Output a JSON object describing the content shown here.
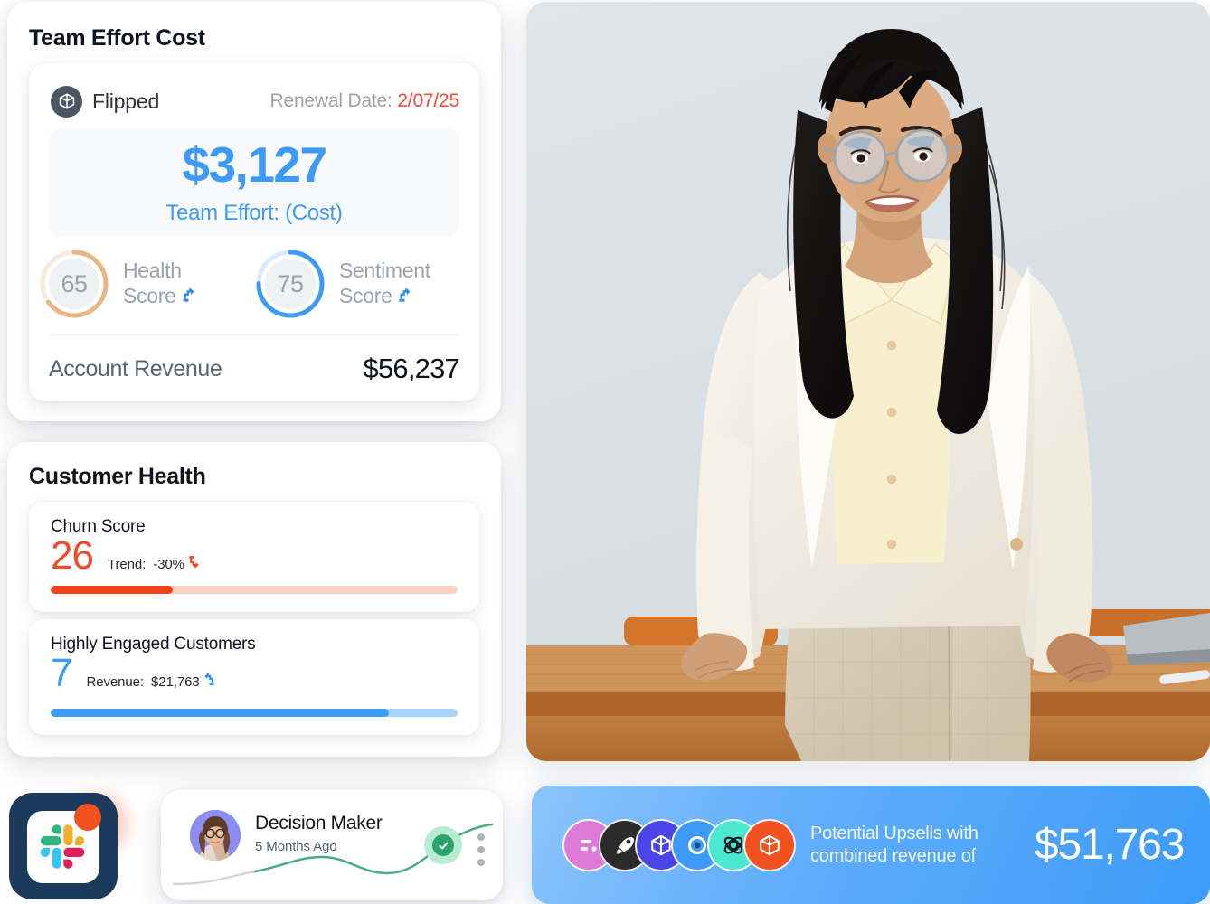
{
  "team_effort_card": {
    "title": "Team Effort Cost",
    "brand_name": "Flipped",
    "brand_icon": "cube-logo-icon",
    "renewal_label": "Renewal Date:",
    "renewal_date": "2/07/25",
    "value_amount": "$3,127",
    "value_caption": "Team Effort: (Cost)",
    "gauges": [
      {
        "score": "65",
        "label_line1": "Health",
        "label_line2": "Score",
        "trend_icon": "arrow-up-icon",
        "percent": 65,
        "color": "#e8b782",
        "track": "#f5ece1"
      },
      {
        "score": "75",
        "label_line1": "Sentiment",
        "label_line2": "Score",
        "trend_icon": "arrow-up-icon",
        "percent": 75,
        "color": "#3d9bf7",
        "track": "#dbeafe"
      }
    ],
    "revenue_label": "Account Revenue",
    "revenue_value": "$56,237"
  },
  "customer_health_card": {
    "title": "Customer Health",
    "churn": {
      "name": "Churn Score",
      "value": "26",
      "sub_label": "Trend:",
      "sub_value": "-30%",
      "trend_icon": "arrow-down-icon",
      "bar_percent": 30,
      "fill_color": "#ef4216",
      "track_color": "#fbcfc2"
    },
    "engaged": {
      "name": "Highly Engaged Customers",
      "value": "7",
      "sub_label": "Revenue:",
      "sub_value": "$21,763",
      "trend_icon": "arrow-up-icon",
      "bar_percent": 83,
      "fill_color": "#3d9bf7",
      "track_color": "#a7d4fb"
    }
  },
  "slack_tile": {
    "icon": "slack-logo-icon",
    "badge": "notification-dot",
    "tile_color": "#1b3a5c",
    "badge_color": "#f2521f"
  },
  "decision_maker_card": {
    "avatar": "user-avatar",
    "name": "Decision Maker",
    "time": "5 Months Ago",
    "status_icon": "check-circle-icon",
    "menu_icon": "more-vertical-icon",
    "sparkline_color": "#3fa87c"
  },
  "photo": {
    "alt": "smiling-businesswoman-leaning-on-desk"
  },
  "upsell_banner": {
    "text_line1": "Potential Upsells with",
    "text_line2": "combined revenue of",
    "amount": "$51,763",
    "logos": [
      {
        "name": "logo-chip-pink",
        "color": "#dd7ad8",
        "icon": "dash-icon"
      },
      {
        "name": "logo-chip-black",
        "color": "#2b2b2b",
        "icon": "rocket-icon"
      },
      {
        "name": "logo-chip-indigo",
        "color": "#4b45e8",
        "icon": "cube-icon"
      },
      {
        "name": "logo-chip-blue",
        "color": "#3d9bf7",
        "icon": "ring-dot-icon"
      },
      {
        "name": "logo-chip-teal",
        "color": "#4ae8d0",
        "icon": "atom-icon"
      },
      {
        "name": "logo-chip-orange",
        "color": "#f2521f",
        "icon": "cube-icon"
      }
    ]
  }
}
